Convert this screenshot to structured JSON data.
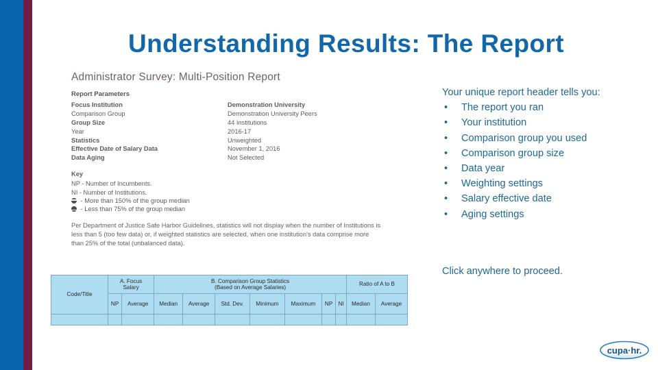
{
  "slide": {
    "title": "Understanding Results: The Report",
    "title_color": "#1167A8",
    "accent_bar_blue": "#0A65AE",
    "accent_bar_maroon": "#6E1E46",
    "body_text_color": "#1C6897",
    "table_fill_color": "#AEDCF0"
  },
  "report": {
    "heading": "Administrator Survey: Multi-Position Report",
    "parameters_title": "Report Parameters",
    "parameters": [
      {
        "label": "Focus Institution",
        "value": "Demonstration University",
        "label_bold": true,
        "value_bold": true
      },
      {
        "label": "Comparison Group",
        "value": "Demonstration University Peers",
        "label_bold": false,
        "value_bold": false
      },
      {
        "label": "Group Size",
        "value": "44 Institutions",
        "label_bold": true,
        "value_bold": false
      },
      {
        "label": "Year",
        "value": "2016-17",
        "label_bold": false,
        "value_bold": false
      },
      {
        "label": "Statistics",
        "value": "Unweighted",
        "label_bold": true,
        "value_bold": false
      },
      {
        "label": "Effective Date of Salary Data",
        "value": "November 1, 2016",
        "label_bold": true,
        "value_bold": false
      },
      {
        "label": "Data Aging",
        "value": "Not Selected",
        "label_bold": true,
        "value_bold": false
      }
    ],
    "key_title": "Key",
    "key_lines": [
      {
        "glyph": "",
        "text": "NP - Number of Incumbents."
      },
      {
        "glyph": "",
        "text": "NI - Number of Institutions."
      },
      {
        "glyph": "circle-up-bar-icon",
        "text": "- More than 150% of the group median"
      },
      {
        "glyph": "circle-down-bar-icon",
        "text": "- Less than 75% of the group median"
      }
    ],
    "footnote": "Per Department of Justice Safe Harbor Guidelines, statistics will not display when the number of Institutions is less than 5 (too few data) or, if weighted statistics are selected, when one institution's data comprise more than 25% of the total (unbalanced data)."
  },
  "data_table": {
    "group_headers": [
      {
        "label": "Code/Title",
        "colspan": 1,
        "rowspan": 2
      },
      {
        "label": "A. Focus Salary",
        "colspan": 2,
        "rowspan": 1
      },
      {
        "label": "B. Comparison Group Statistics (Based on Average Salaries)",
        "colspan": 7,
        "rowspan": 1
      },
      {
        "label": "Ratio of A to B",
        "colspan": 2,
        "rowspan": 1
      }
    ],
    "group_header_a": "A. Focus",
    "group_header_a2": "Salary",
    "group_header_b": "B. Comparison Group Statistics",
    "group_header_b2": "(Based on Average Salaries)",
    "group_header_ratio": "Ratio of A to B",
    "code_title": "Code/Title",
    "sub_headers": [
      "NP",
      "Average",
      "Median",
      "Average",
      "Std. Dev.",
      "Minimum",
      "Maximum",
      "NP",
      "NI",
      "Median",
      "Average"
    ]
  },
  "narrative": {
    "lead": "Your unique report header tells you:",
    "bullet_marker": "•",
    "bullets": [
      "The report you ran",
      "Your institution",
      "Comparison group you used",
      "Comparison group size",
      "Data year",
      "Weighting settings",
      "Salary effective date",
      "Aging settings"
    ],
    "cta": "Click anywhere to proceed."
  },
  "logo": {
    "name": "cupa-hr-logo",
    "text": "cupa-hr."
  }
}
